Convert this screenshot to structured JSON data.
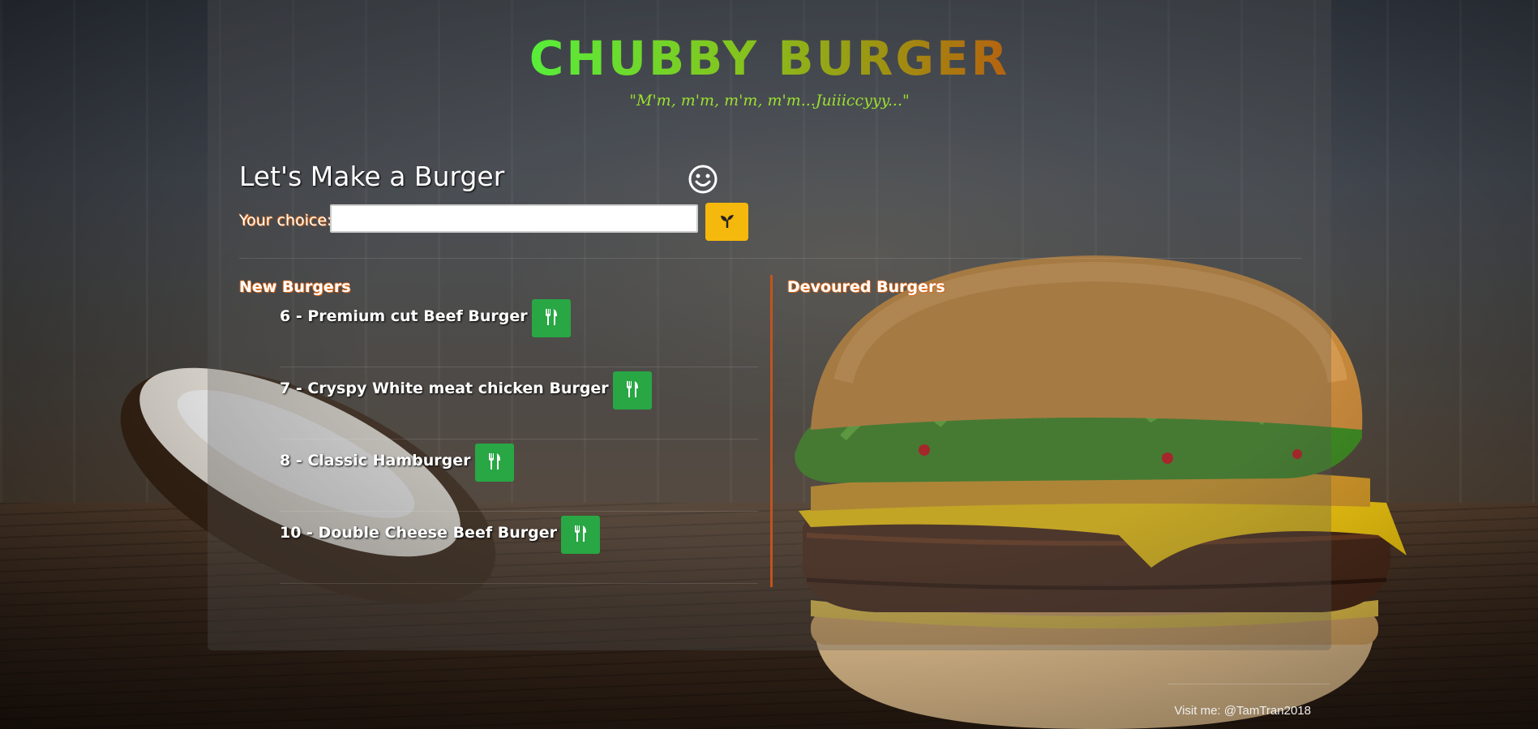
{
  "brand": {
    "title": "CHUBBY BURGER",
    "tagline": "\"M'm, m'm, m'm, m'm...Juiiiccyyy...\""
  },
  "form": {
    "heading": "Let's Make a Burger",
    "heading_icon": "smile-icon",
    "label": "Your choice:",
    "input_value": "",
    "submit_icon": "sprout-icon",
    "submit_color": "#f5b80c"
  },
  "columns": {
    "new_title": "New Burgers",
    "devoured_title": "Devoured Burgers"
  },
  "new_burgers": [
    {
      "label": "6 - Premium cut Beef Burger"
    },
    {
      "label": "7 - Cryspy White meat chicken Burger"
    },
    {
      "label": "8 - Classic Hamburger"
    },
    {
      "label": "10 - Double Cheese Beef Burger"
    }
  ],
  "devour_button": {
    "icon": "utensils-icon",
    "color": "#28a744"
  },
  "footer": {
    "text": "Visit me: @TamTran2018"
  },
  "colors": {
    "accent_orange": "#c0541e",
    "tagline_green": "#9be02f"
  }
}
